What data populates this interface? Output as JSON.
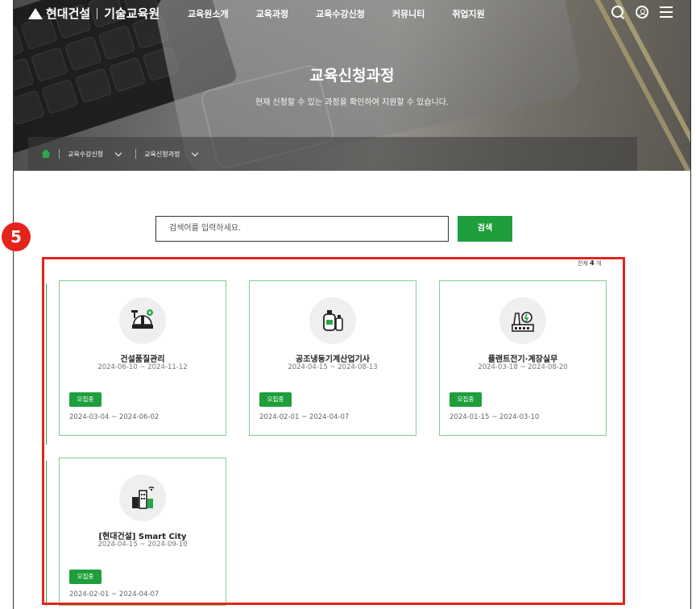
{
  "header": {
    "logo_company": "현대건설",
    "logo_division": "기술교육원",
    "nav": [
      "교육원소개",
      "교육과정",
      "교육수강신청",
      "커뮤니티",
      "취업지원"
    ],
    "icons": [
      "search-icon",
      "user-icon",
      "menu-icon"
    ]
  },
  "hero": {
    "title": "교육신청과정",
    "subtitle": "현재 신청할 수 있는 과정을 확인하여 지원할 수 있습니다."
  },
  "breadcrumb": {
    "items": [
      "교육수강신청",
      "교육신청과정"
    ]
  },
  "search": {
    "placeholder": "검색어를 입력하세요.",
    "button_label": "검색"
  },
  "annotation": {
    "marker_number": "5"
  },
  "list": {
    "total_prefix": "전체",
    "total_count": "4",
    "total_suffix": "개",
    "courses": [
      {
        "icon": "construction-quality-icon",
        "name": "건설품질관리",
        "period": "2024-06-10 ~ 2024-11-12",
        "status": "모집중",
        "apply_period": "2024-03-04 ~ 2024-06-02"
      },
      {
        "icon": "refrigeration-equipment-icon",
        "name": "공조냉동기계산업기사",
        "period": "2024-04-15 ~ 2024-08-13",
        "status": "모집중",
        "apply_period": "2024-02-01 ~ 2024-04-07"
      },
      {
        "icon": "plant-electric-icon",
        "name": "플랜트전기·계장실무",
        "period": "2024-03-18 ~ 2024-08-20",
        "status": "모집중",
        "apply_period": "2024-01-15 ~ 2024-03-10"
      },
      {
        "icon": "smart-city-icon",
        "name": "[현대건설] Smart City",
        "period": "2024-04-15 ~ 2024-09-10",
        "status": "모집중",
        "apply_period": "2024-02-01 ~ 2024-04-07"
      }
    ]
  },
  "colors": {
    "accent_green": "#1e9f3c",
    "card_border": "#7fd08f",
    "annotation_red": "#e4231c"
  }
}
